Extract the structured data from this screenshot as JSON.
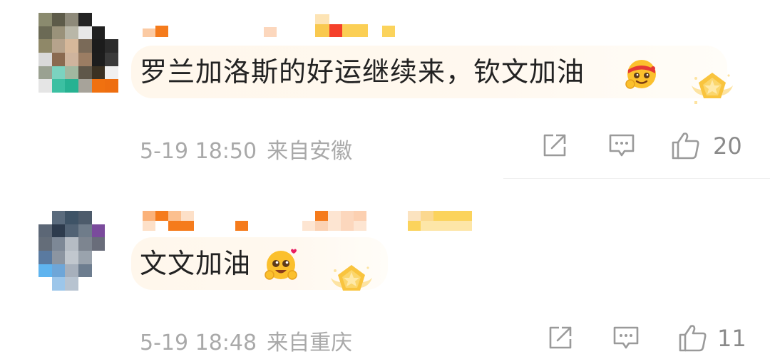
{
  "comments": [
    {
      "text": "罗兰加洛斯的好运继续来，钦文加油",
      "time": "5-19 18:50",
      "location": "来自安徽",
      "likes": "20",
      "emoji": "face-with-red-headband-emoji",
      "badge": "gold-star-badge-icon"
    },
    {
      "text": "文文加油",
      "time": "5-19 18:48",
      "location": "来自重庆",
      "likes": "11",
      "emoji": "heart-eyes-cheer-emoji",
      "badge": "gold-star-badge-icon"
    }
  ],
  "colors": {
    "text": "#222222",
    "meta": "#a9a9a9",
    "icon": "#9a9a9a",
    "bubble": "#fff7ec",
    "accent_orange": "#f57b1c",
    "accent_gold": "#f7b62a"
  }
}
